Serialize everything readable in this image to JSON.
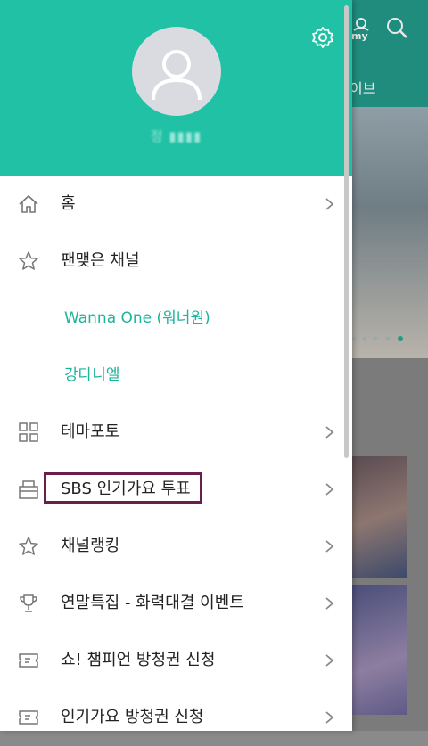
{
  "background": {
    "header_text": "이브",
    "my_label": "my"
  },
  "drawer": {
    "username": "정 ▮▮▮▮",
    "menu": [
      {
        "label": "홈",
        "icon": "home-icon",
        "chevron": true
      },
      {
        "label": "팬맺은 채널",
        "icon": "star-icon",
        "chevron": false
      },
      {
        "label": "Wanna One (워너원)",
        "icon": "",
        "chevron": false,
        "sub": true
      },
      {
        "label": "강다니엘",
        "icon": "",
        "chevron": false,
        "sub": true
      },
      {
        "label": "테마포토",
        "icon": "grid-icon",
        "chevron": true
      },
      {
        "label": "SBS 인기가요 투표",
        "icon": "ballot-box-icon",
        "chevron": true
      },
      {
        "label": "채널랭킹",
        "icon": "star-icon",
        "chevron": true
      },
      {
        "label": "연말특집 - 화력대결 이벤트",
        "icon": "trophy-icon",
        "chevron": true
      },
      {
        "label": "쇼! 챔피언 방청권 신청",
        "icon": "ticket-icon",
        "chevron": true
      },
      {
        "label": "인기가요 방청권 신청",
        "icon": "ticket-icon",
        "chevron": true
      }
    ]
  },
  "colors": {
    "header": "#20c1a5",
    "accent_text": "#1cb59b",
    "highlight_border": "#6b1e4a"
  }
}
